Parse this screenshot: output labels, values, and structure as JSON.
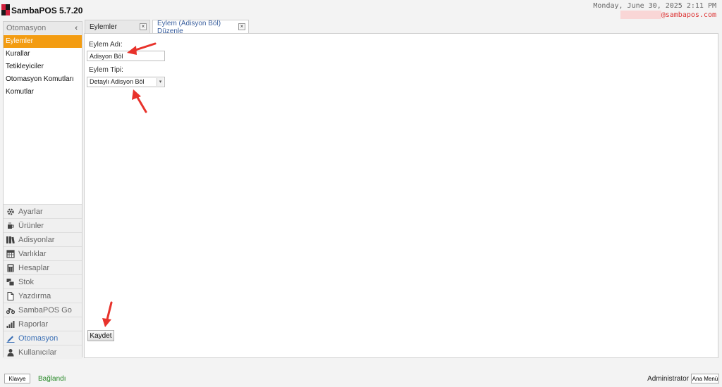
{
  "app": {
    "title": "SambaPOS 5.7.20",
    "datetime": "Monday, June 30, 2025 2:11 PM",
    "email": "@sambapos.com",
    "logo_icon": "sambapos-logo-icon"
  },
  "sidebar": {
    "header": "Otomasyon",
    "collapse_icon": "chevron-left-icon",
    "sub_items": [
      {
        "label": "Eylemler",
        "active": true
      },
      {
        "label": "Kurallar",
        "active": false
      },
      {
        "label": "Tetikleyiciler",
        "active": false
      },
      {
        "label": "Otomasyon Komutları",
        "active": false
      },
      {
        "label": "Komutlar",
        "active": false
      }
    ],
    "nav_items": [
      {
        "label": "Ayarlar",
        "icon": "gear-icon"
      },
      {
        "label": "Ürünler",
        "icon": "coffee-icon"
      },
      {
        "label": "Adisyonlar",
        "icon": "books-icon"
      },
      {
        "label": "Varlıklar",
        "icon": "table-icon"
      },
      {
        "label": "Hesaplar",
        "icon": "calculator-icon"
      },
      {
        "label": "Stok",
        "icon": "stock-icon"
      },
      {
        "label": "Yazdırma",
        "icon": "document-icon"
      },
      {
        "label": "SambaPOS Go",
        "icon": "motorcycle-icon"
      },
      {
        "label": "Raporlar",
        "icon": "bar-chart-icon"
      },
      {
        "label": "Otomasyon",
        "icon": "pencil-icon",
        "active": true
      },
      {
        "label": "Kullanıcılar",
        "icon": "user-icon"
      }
    ]
  },
  "tabs": [
    {
      "label": "Eylemler",
      "active": false
    },
    {
      "label": "Eylem (Adisyon Böl) Düzenle",
      "active": true
    }
  ],
  "tab_close": "×",
  "form": {
    "name_label": "Eylem Adı:",
    "name_value": "Adisyon Böl",
    "type_label": "Eylem Tipi:",
    "type_value": "Detaylı Adisyon Böl",
    "save_label": "Kaydet"
  },
  "status": {
    "keyboard_label": "Klavye",
    "connection": "Bağlandı",
    "user": "Administrator",
    "main_menu_label": "Ana Menü"
  },
  "colors": {
    "accent": "#f39c11",
    "annotation": "#e8322b",
    "connected": "#2a8a2a",
    "active_tab_text": "#3a5f9e"
  }
}
